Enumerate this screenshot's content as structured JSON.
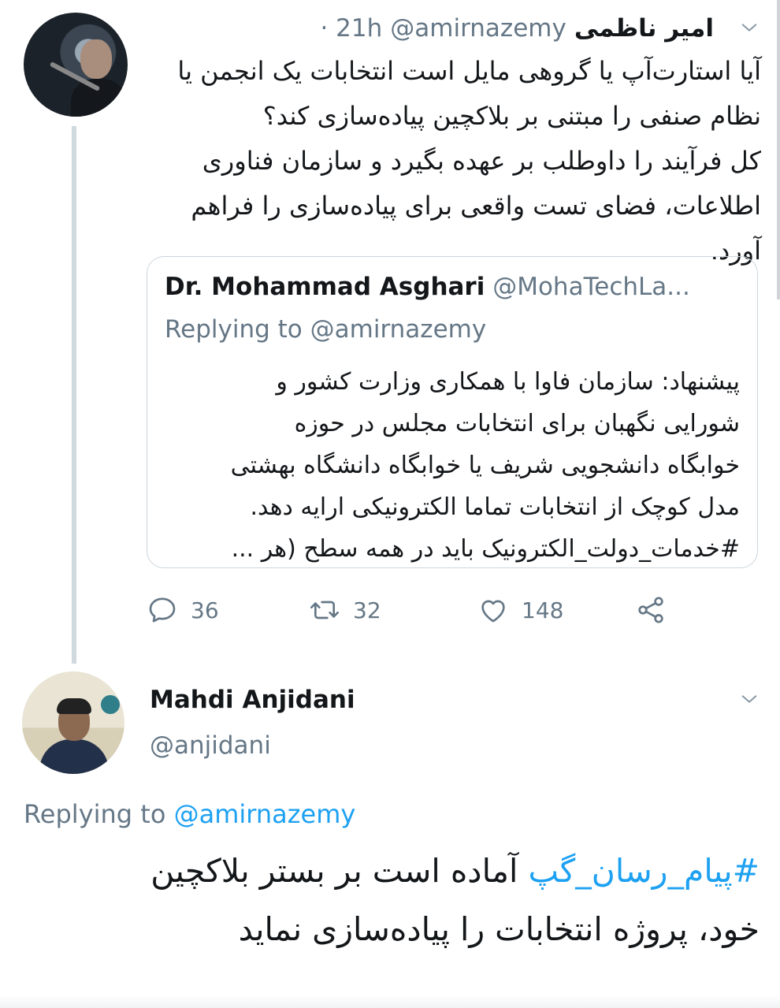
{
  "tweet1": {
    "name": "امیر ناظمی",
    "handle": "@amirnazemy",
    "time": "· 21h",
    "body_lines": [
      "آیا استارت‌آپ یا گروهی مایل است انتخابات یک انجمن یا",
      "نظام صنفی را مبتنی بر بلاکچین پیاده‌سازی کند؟",
      "کل فرآیند را داوطلب بر عهده بگیرد و سازمان فناوری",
      "اطلاعات، فضای تست واقعی برای پیاده‌سازی را فراهم",
      "آورد."
    ],
    "quoted": {
      "name": "Dr. Mohammad Asghari",
      "handle": "@MohaTechLa...",
      "replying_prefix": "Replying to",
      "replying_handle": "@amirnazemy",
      "body_lines": [
        "پیشنهاد: سازمان فاوا با همکاری وزارت کشور و",
        "شورایی نگهبان برای انتخابات مجلس در حوزه",
        "خوابگاه دانشجویی شریف یا خوابگاه دانشگاه بهشتی",
        "مدل کوچک از انتخابات تماما الکترونیکی ارایه دهد.",
        "#خدمات_دولت_الکترونیک باید در همه سطح (هر ..."
      ]
    },
    "actions": {
      "replies": "36",
      "retweets": "32",
      "likes": "148"
    }
  },
  "tweet2": {
    "name": "Mahdi Anjidani",
    "handle": "@anjidani",
    "replying_prefix": "Replying to",
    "replying_handle": "@amirnazemy",
    "hashtag": "#پیام_رسان_گپ",
    "body_line1_rest": " آماده است بر بستر بلاکچین",
    "body_line2": "خود، پروژه انتخابات را پیاده‌سازی نماید"
  },
  "icons": [
    "chevron-down-icon",
    "reply-icon",
    "retweet-icon",
    "like-icon",
    "share-icon"
  ],
  "colors": {
    "link": "#1da1f2",
    "muted": "#657786",
    "text": "#14171a",
    "border": "#ccd6dd"
  }
}
